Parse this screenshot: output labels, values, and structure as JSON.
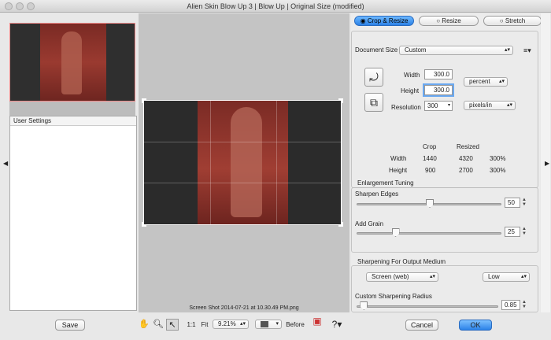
{
  "window": {
    "title": "Alien Skin Blow Up 3 | Blow Up | Original Size (modified)"
  },
  "left": {
    "user_settings_label": "User Settings"
  },
  "center": {
    "filename": "Screen Shot 2014-07-21 at 10.30.49 PM.png"
  },
  "tabs": [
    {
      "label": "Crop & Resize",
      "active": true
    },
    {
      "label": "Resize",
      "active": false
    },
    {
      "label": "Stretch",
      "active": false
    }
  ],
  "document": {
    "size_label": "Document Size",
    "size_value": "Custom",
    "width_label": "Width",
    "width_value": "300.0",
    "height_label": "Height",
    "height_value": "300.0",
    "unit_value": "percent",
    "resolution_label": "Resolution",
    "resolution_value": "300",
    "res_unit_value": "pixels/in"
  },
  "size_table": {
    "headers": [
      "Crop",
      "Resized"
    ],
    "rows": [
      {
        "label": "Width",
        "crop": "1440",
        "resized": "4320",
        "pct": "300%"
      },
      {
        "label": "Height",
        "crop": "900",
        "resized": "2700",
        "pct": "300%"
      }
    ]
  },
  "enlargement": {
    "title": "Enlargement Tuning",
    "sharpen_label": "Sharpen Edges",
    "sharpen_value": "50",
    "sharpen_level": 0.5,
    "grain_label": "Add Grain",
    "grain_value": "25",
    "grain_level": 0.25
  },
  "sharpening": {
    "title": "Sharpening For Output Medium",
    "medium_value": "Screen (web)",
    "amount_value": "Low",
    "radius_label": "Custom Sharpening Radius",
    "radius_value": "0.85",
    "radius_level": 0.02
  },
  "bottom": {
    "save_label": "Save",
    "zoom_11": "1:1",
    "fit_label": "Fit",
    "zoom_value": "9.21%",
    "before_label": "Before",
    "cancel_label": "Cancel",
    "ok_label": "OK"
  },
  "colors": {
    "accent": "#2c82e6"
  }
}
